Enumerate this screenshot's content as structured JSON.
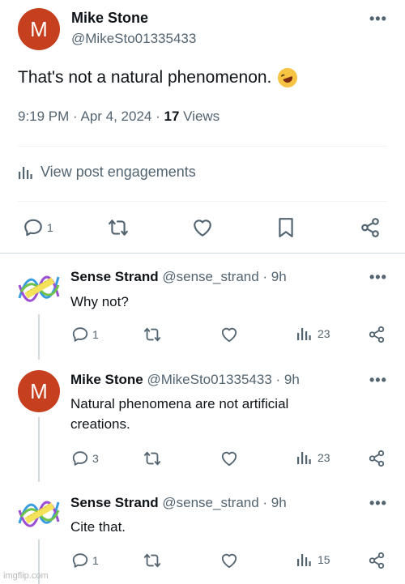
{
  "main_post": {
    "avatar_letter": "M",
    "author_name": "Mike Stone",
    "author_handle": "@MikeSto01335433",
    "more": "•••",
    "text": "That's not a natural phenomenon.",
    "emoji": "rolling-on-floor-laughing",
    "timestamp": "9:19 PM · Apr 4, 2024 · ",
    "views_count": "17",
    "views_label": " Views",
    "engagements_label": "View post engagements",
    "reply_count": "1"
  },
  "replies": [
    {
      "author_name": "Sense Strand",
      "handle_time": " @sense_strand · 9h",
      "text": "Why not?",
      "reply_count": "1",
      "views_count": "23"
    },
    {
      "avatar_letter": "M",
      "author_name": "Mike Stone",
      "handle_time": " @MikeSto01335433 · 9h",
      "text": "Natural phenomena are not artificial creations.",
      "reply_count": "3",
      "views_count": "23"
    },
    {
      "author_name": "Sense Strand",
      "handle_time": " @sense_strand · 9h",
      "text": "Cite that.",
      "reply_count": "1",
      "views_count": "15"
    }
  ],
  "watermark": "imgflip.com",
  "colors": {
    "avatar_red": "#c63f1e",
    "secondary_text": "#536471",
    "primary_text": "#0f1419"
  }
}
